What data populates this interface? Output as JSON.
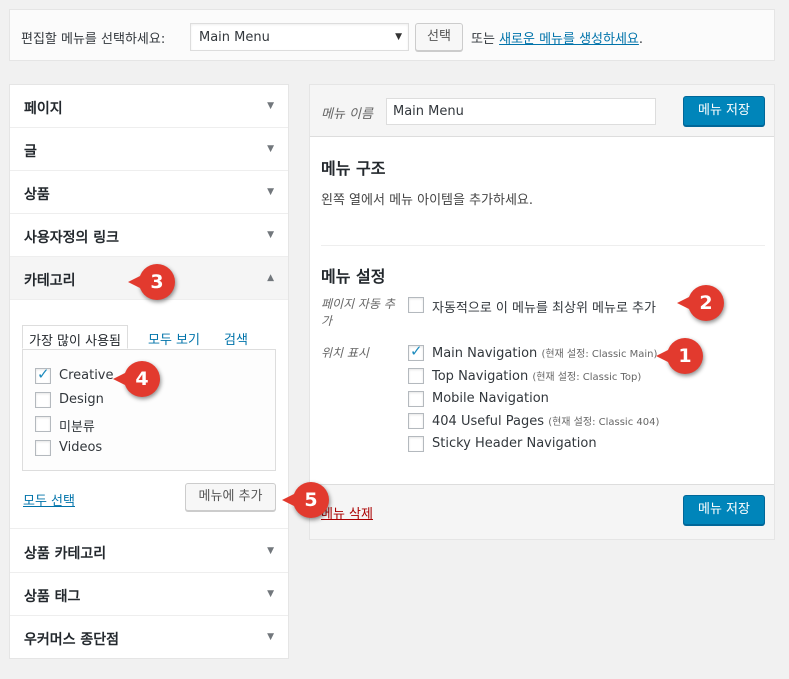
{
  "top_bar": {
    "label": "편집할 메뉴를 선택하세요:",
    "selected_menu": "Main Menu",
    "select_button": "선택",
    "or_text": "또는",
    "create_link": "새로운 메뉴를 생성하세요",
    "period": "."
  },
  "left": {
    "sections": [
      "페이지",
      "글",
      "상품",
      "사용자정의 링크",
      "카테고리",
      "상품 카테고리",
      "상품 태그",
      "우커머스 종단점"
    ],
    "category_panel": {
      "tabs": [
        "가장 많이 사용됨",
        "모두 보기",
        "검색"
      ],
      "items": [
        {
          "label": "Creative",
          "checked": true
        },
        {
          "label": "Design",
          "checked": false
        },
        {
          "label": "미분류",
          "checked": false
        },
        {
          "label": "Videos",
          "checked": false
        }
      ],
      "select_all": "모두 선택",
      "add_button": "메뉴에 추가"
    }
  },
  "right": {
    "name_label": "메뉴 이름",
    "name_value": "Main Menu",
    "save_button": "메뉴 저장",
    "structure_title": "메뉴 구조",
    "structure_desc": "왼쪽 열에서 메뉴 아이템을 추가하세요.",
    "settings_title": "메뉴 설정",
    "auto_add_label_1": "페이지 자동 추",
    "auto_add_label_2": "가",
    "auto_add_text": "자동적으로 이 메뉴를 최상위 메뉴로 추가",
    "location_label": "위치 표시",
    "locations": [
      {
        "label": "Main Navigation",
        "current": "(현재 설정: Classic Main)",
        "checked": true
      },
      {
        "label": "Top Navigation",
        "current": "(현재 설정: Classic Top)",
        "checked": false
      },
      {
        "label": "Mobile Navigation",
        "current": "",
        "checked": false
      },
      {
        "label": "404 Useful Pages",
        "current": "(현재 설정: Classic 404)",
        "checked": false
      },
      {
        "label": "Sticky Header Navigation",
        "current": "",
        "checked": false
      }
    ],
    "delete_link": "메뉴 삭제"
  },
  "badges": [
    "1",
    "2",
    "3",
    "4",
    "5"
  ],
  "colors": {
    "primary": "#0085ba",
    "link": "#0073aa",
    "badge": "#e23a2e",
    "delete": "#aa0000"
  }
}
